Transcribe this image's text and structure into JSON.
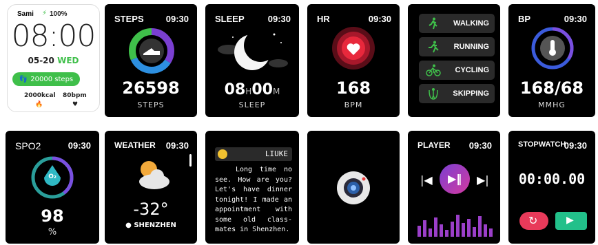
{
  "watchface": {
    "user": "Sami",
    "battery": "100%",
    "time": "08:00",
    "date": "05-20",
    "weekday": "WED",
    "steps_pill": "20000 steps",
    "kcal": "2000kcal",
    "bpm": "80bpm"
  },
  "steps": {
    "title": "STEPS",
    "time": "09:30",
    "value": "26598",
    "label": "STEPS"
  },
  "sleep": {
    "title": "SLEEP",
    "time": "09:30",
    "hours": "08",
    "h": "H",
    "minutes": "00",
    "m": "M",
    "label": "SLEEP"
  },
  "hr": {
    "title": "HR",
    "time": "09:30",
    "value": "168",
    "label": "BPM"
  },
  "sports": {
    "items": [
      {
        "label": "WALKING",
        "icon": "walking-icon"
      },
      {
        "label": "RUNNING",
        "icon": "running-icon"
      },
      {
        "label": "CYCLING",
        "icon": "cycling-icon"
      },
      {
        "label": "SKIPPING",
        "icon": "skipping-icon"
      }
    ]
  },
  "bp": {
    "title": "BP",
    "time": "09:30",
    "value": "168/68",
    "label": "MMHG"
  },
  "spo2": {
    "title": "SPO2",
    "time": "09:30",
    "drop": "O₂",
    "value": "98",
    "label": "%"
  },
  "weather": {
    "title": "WEATHER",
    "time": "09:30",
    "temp": "-32°",
    "city": "SHENZHEN"
  },
  "message": {
    "sender": "LIUKE",
    "text": "Long time no see. How are you? Let's have dinner tonight! I made an appointment with some old class-mates in Shenzhen."
  },
  "player": {
    "title": "PLAYER",
    "time": "09:30"
  },
  "stopwatch": {
    "title": "STOPWATCH",
    "time": "09:30",
    "value": "00:00.00"
  },
  "colors": {
    "accent_green": "#3fbf4a",
    "hr_red": "#e8283c",
    "bp_blue": "#3b5bdb",
    "player_pink": "#d43aa0",
    "stop_red": "#e83a5a",
    "play_green": "#22c08a"
  }
}
